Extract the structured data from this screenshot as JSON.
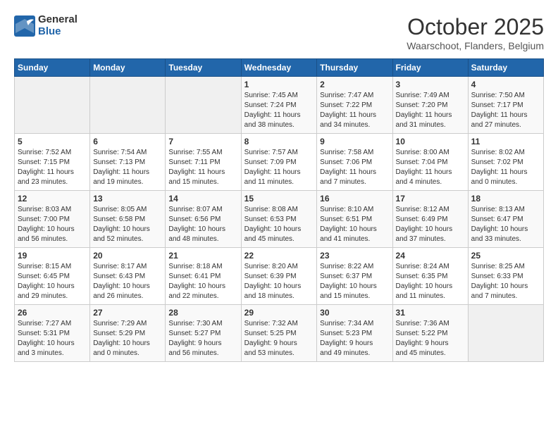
{
  "header": {
    "logo_general": "General",
    "logo_blue": "Blue",
    "month_title": "October 2025",
    "location": "Waarschoot, Flanders, Belgium"
  },
  "days_of_week": [
    "Sunday",
    "Monday",
    "Tuesday",
    "Wednesday",
    "Thursday",
    "Friday",
    "Saturday"
  ],
  "weeks": [
    [
      {
        "day": "",
        "info": ""
      },
      {
        "day": "",
        "info": ""
      },
      {
        "day": "",
        "info": ""
      },
      {
        "day": "1",
        "info": "Sunrise: 7:45 AM\nSunset: 7:24 PM\nDaylight: 11 hours\nand 38 minutes."
      },
      {
        "day": "2",
        "info": "Sunrise: 7:47 AM\nSunset: 7:22 PM\nDaylight: 11 hours\nand 34 minutes."
      },
      {
        "day": "3",
        "info": "Sunrise: 7:49 AM\nSunset: 7:20 PM\nDaylight: 11 hours\nand 31 minutes."
      },
      {
        "day": "4",
        "info": "Sunrise: 7:50 AM\nSunset: 7:17 PM\nDaylight: 11 hours\nand 27 minutes."
      }
    ],
    [
      {
        "day": "5",
        "info": "Sunrise: 7:52 AM\nSunset: 7:15 PM\nDaylight: 11 hours\nand 23 minutes."
      },
      {
        "day": "6",
        "info": "Sunrise: 7:54 AM\nSunset: 7:13 PM\nDaylight: 11 hours\nand 19 minutes."
      },
      {
        "day": "7",
        "info": "Sunrise: 7:55 AM\nSunset: 7:11 PM\nDaylight: 11 hours\nand 15 minutes."
      },
      {
        "day": "8",
        "info": "Sunrise: 7:57 AM\nSunset: 7:09 PM\nDaylight: 11 hours\nand 11 minutes."
      },
      {
        "day": "9",
        "info": "Sunrise: 7:58 AM\nSunset: 7:06 PM\nDaylight: 11 hours\nand 7 minutes."
      },
      {
        "day": "10",
        "info": "Sunrise: 8:00 AM\nSunset: 7:04 PM\nDaylight: 11 hours\nand 4 minutes."
      },
      {
        "day": "11",
        "info": "Sunrise: 8:02 AM\nSunset: 7:02 PM\nDaylight: 11 hours\nand 0 minutes."
      }
    ],
    [
      {
        "day": "12",
        "info": "Sunrise: 8:03 AM\nSunset: 7:00 PM\nDaylight: 10 hours\nand 56 minutes."
      },
      {
        "day": "13",
        "info": "Sunrise: 8:05 AM\nSunset: 6:58 PM\nDaylight: 10 hours\nand 52 minutes."
      },
      {
        "day": "14",
        "info": "Sunrise: 8:07 AM\nSunset: 6:56 PM\nDaylight: 10 hours\nand 48 minutes."
      },
      {
        "day": "15",
        "info": "Sunrise: 8:08 AM\nSunset: 6:53 PM\nDaylight: 10 hours\nand 45 minutes."
      },
      {
        "day": "16",
        "info": "Sunrise: 8:10 AM\nSunset: 6:51 PM\nDaylight: 10 hours\nand 41 minutes."
      },
      {
        "day": "17",
        "info": "Sunrise: 8:12 AM\nSunset: 6:49 PM\nDaylight: 10 hours\nand 37 minutes."
      },
      {
        "day": "18",
        "info": "Sunrise: 8:13 AM\nSunset: 6:47 PM\nDaylight: 10 hours\nand 33 minutes."
      }
    ],
    [
      {
        "day": "19",
        "info": "Sunrise: 8:15 AM\nSunset: 6:45 PM\nDaylight: 10 hours\nand 29 minutes."
      },
      {
        "day": "20",
        "info": "Sunrise: 8:17 AM\nSunset: 6:43 PM\nDaylight: 10 hours\nand 26 minutes."
      },
      {
        "day": "21",
        "info": "Sunrise: 8:18 AM\nSunset: 6:41 PM\nDaylight: 10 hours\nand 22 minutes."
      },
      {
        "day": "22",
        "info": "Sunrise: 8:20 AM\nSunset: 6:39 PM\nDaylight: 10 hours\nand 18 minutes."
      },
      {
        "day": "23",
        "info": "Sunrise: 8:22 AM\nSunset: 6:37 PM\nDaylight: 10 hours\nand 15 minutes."
      },
      {
        "day": "24",
        "info": "Sunrise: 8:24 AM\nSunset: 6:35 PM\nDaylight: 10 hours\nand 11 minutes."
      },
      {
        "day": "25",
        "info": "Sunrise: 8:25 AM\nSunset: 6:33 PM\nDaylight: 10 hours\nand 7 minutes."
      }
    ],
    [
      {
        "day": "26",
        "info": "Sunrise: 7:27 AM\nSunset: 5:31 PM\nDaylight: 10 hours\nand 3 minutes."
      },
      {
        "day": "27",
        "info": "Sunrise: 7:29 AM\nSunset: 5:29 PM\nDaylight: 10 hours\nand 0 minutes."
      },
      {
        "day": "28",
        "info": "Sunrise: 7:30 AM\nSunset: 5:27 PM\nDaylight: 9 hours\nand 56 minutes."
      },
      {
        "day": "29",
        "info": "Sunrise: 7:32 AM\nSunset: 5:25 PM\nDaylight: 9 hours\nand 53 minutes."
      },
      {
        "day": "30",
        "info": "Sunrise: 7:34 AM\nSunset: 5:23 PM\nDaylight: 9 hours\nand 49 minutes."
      },
      {
        "day": "31",
        "info": "Sunrise: 7:36 AM\nSunset: 5:22 PM\nDaylight: 9 hours\nand 45 minutes."
      },
      {
        "day": "",
        "info": ""
      }
    ]
  ]
}
